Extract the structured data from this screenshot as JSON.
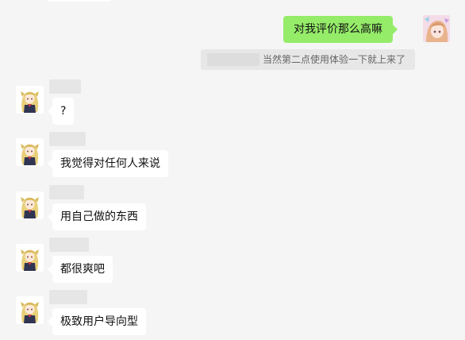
{
  "chat": {
    "sent": {
      "text": "对我评价那么高嘛"
    },
    "quote": {
      "text": "当然第二点使用体验一下就上来了"
    },
    "received": [
      {
        "text": "?"
      },
      {
        "text": "我觉得对任何人来说"
      },
      {
        "text": "用自己做的东西"
      },
      {
        "text": "都很爽吧"
      },
      {
        "text": "极致用户导向型"
      }
    ]
  },
  "colors": {
    "background": "#f5f5f5",
    "sent_bubble": "#95ec69",
    "received_bubble": "#ffffff",
    "quote_box": "#e7e7e7",
    "quote_text": "#666666"
  },
  "icons": {
    "sent_avatar": "anime-girl-avatar",
    "received_avatar": "anime-blonde-girl-avatar"
  }
}
